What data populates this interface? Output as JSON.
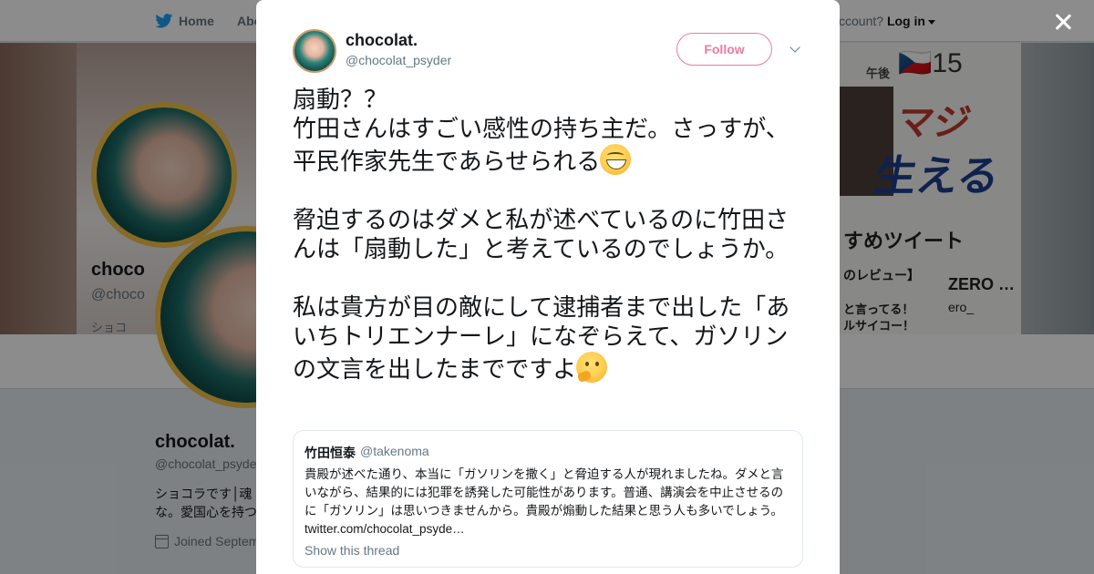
{
  "nav": {
    "home_label": "Home",
    "about_label": "Abo",
    "account_prompt": "ccount?",
    "login_label": "Log in"
  },
  "background": {
    "banner_flag_count": "🇨🇿15",
    "banner_text_1": "マジ",
    "banner_text_2": "生える",
    "banner_text_3": "すめツイート",
    "banner_text_4": "のレビュー】",
    "banner_text_5": "ZERO …",
    "banner_text_6": "と言ってる！",
    "banner_text_7": "ルサイコー！",
    "banner_text_8": "ero_",
    "banner_text_9": "午後",
    "side_name": "choco",
    "side_handle": "@choco",
    "side_bio_start": "ショコ",
    "name": "chocolat.",
    "handle": "@chocolat_psyde",
    "bio_line1": "ショコラです│魂",
    "bio_line2": "な。愛国心を持つ",
    "joined": "Joined Septem"
  },
  "tweet": {
    "author_name": "chocolat.",
    "author_handle": "@chocolat_psyder",
    "follow_label": "Follow",
    "paragraphs": [
      "扇動？？",
      "竹田さんはすごい感性の持ち主だ。さっすが、平民作家先生であらせられる",
      "",
      "脅迫するのはダメと私が述べているのに竹田さんは「扇動した」と考えているのでしょうか。",
      "",
      "私は貴方が目の敵にして逮捕者まで出した「あいちトリエンナーレ」になぞらえて、ガソリンの文言を出したまでですよ"
    ],
    "emoji_1": "grinning-face-with-smiling-eyes",
    "emoji_2": "thinking-face"
  },
  "quote": {
    "name": "竹田恒泰",
    "handle": "@takenoma",
    "body": "貴殿が述べた通り、本当に「ガソリンを撒く」と脅迫する人が現れましたね。ダメと言いながら、結果的には犯罪を誘発した可能性があります。普通、講演会を中止させるのに「ガソリン」は思いつきませんから。貴殿が煽動した結果と思う人も多いでしょう。",
    "link": "twitter.com/chocolat_psyde…",
    "show_thread": "Show this thread"
  },
  "colors": {
    "follow": "#e0245e",
    "twitter_blue": "#1da1f2",
    "text": "#14171a",
    "muted": "#657786"
  }
}
